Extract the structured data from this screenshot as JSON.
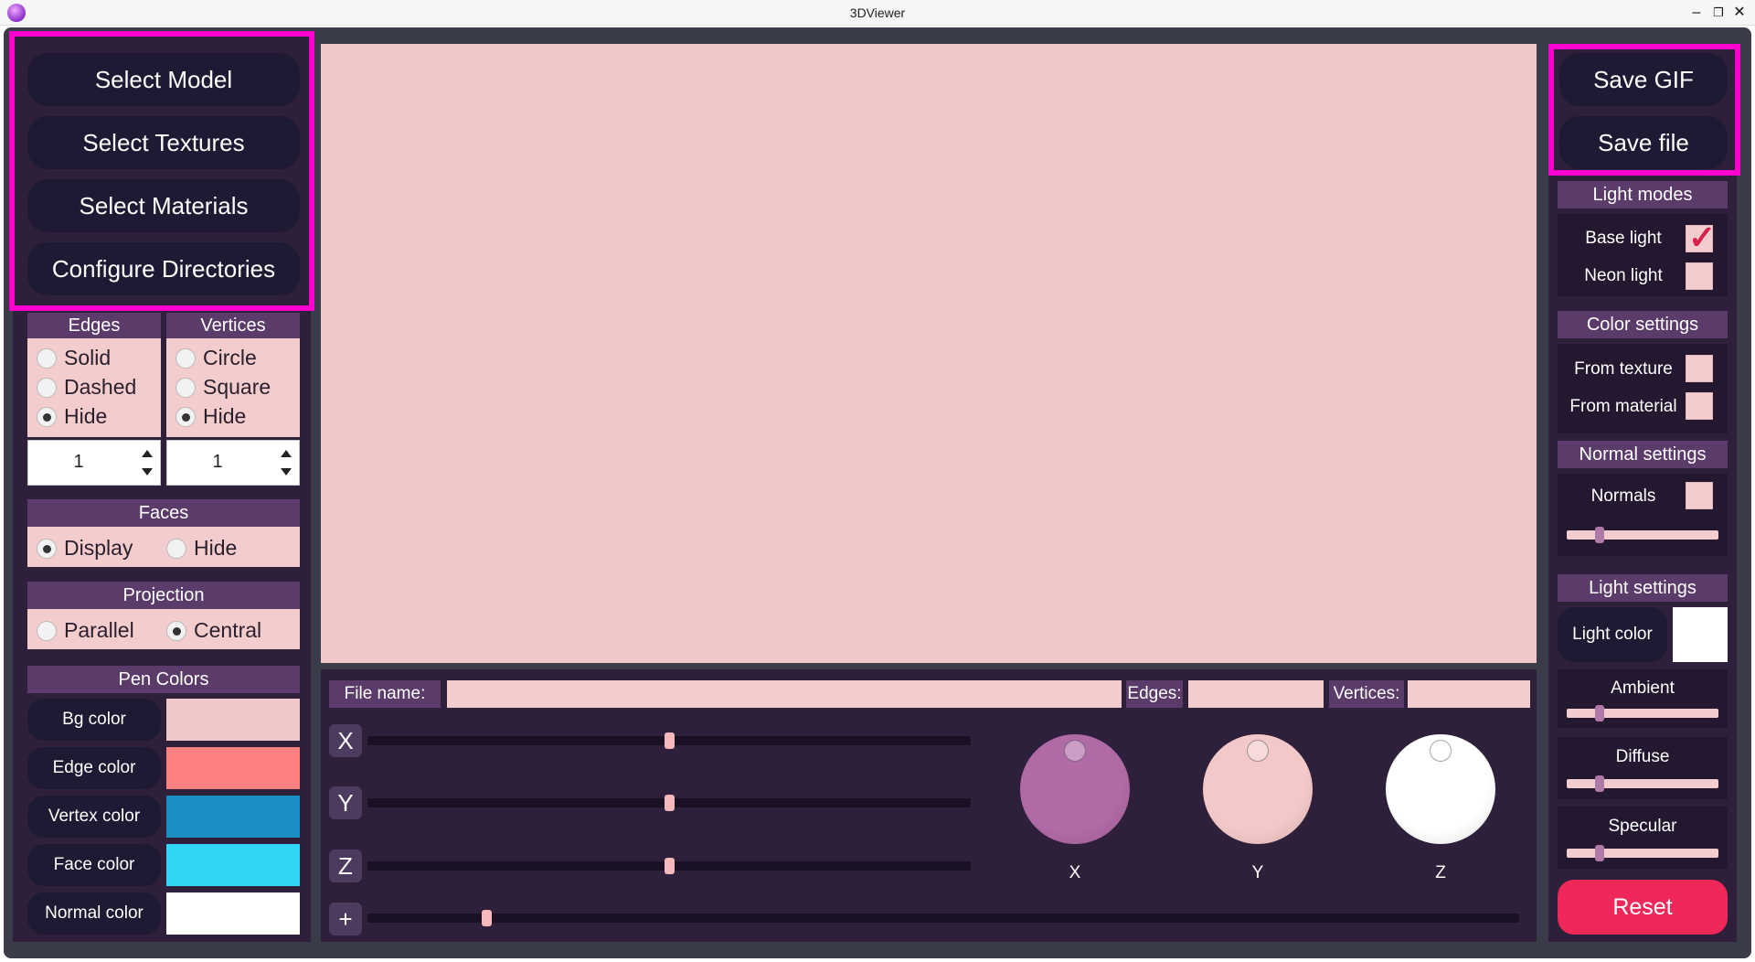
{
  "window": {
    "title": "3DViewer",
    "minimize": "–",
    "restore": "❐",
    "close": "✕"
  },
  "left": {
    "buttons": [
      "Select Model",
      "Select Textures",
      "Select Materials",
      "Configure Directories"
    ],
    "edges": {
      "header": "Edges",
      "options": [
        "Solid",
        "Dashed",
        "Hide"
      ],
      "selected": "Hide",
      "thickness": "1"
    },
    "vertices": {
      "header": "Vertices",
      "options": [
        "Circle",
        "Square",
        "Hide"
      ],
      "selected": "Hide",
      "size": "1"
    },
    "faces": {
      "header": "Faces",
      "options": [
        "Display",
        "Hide"
      ],
      "selected": "Display"
    },
    "projection": {
      "header": "Projection",
      "options": [
        "Parallel",
        "Central"
      ],
      "selected": "Central"
    },
    "pen_colors": {
      "header": "Pen Colors",
      "items": [
        {
          "label": "Bg color",
          "color": "#f0c8c9"
        },
        {
          "label": "Edge color",
          "color": "#ff8080"
        },
        {
          "label": "Vertex color",
          "color": "#1b8fc4"
        },
        {
          "label": "Face color",
          "color": "#33d5f5"
        },
        {
          "label": "Normal color",
          "color": "#ffffff"
        }
      ]
    }
  },
  "viewport": {
    "background": "#f0c8c9"
  },
  "bottom": {
    "file_name_label": "File name:",
    "file_name_value": "",
    "edges_label": "Edges:",
    "edges_value": "",
    "vertices_label": "Vertices:",
    "vertices_value": "",
    "move_axes": [
      "X",
      "Y",
      "Z"
    ],
    "move_values": [
      0.5,
      0.5,
      0.5
    ],
    "scale_label": "+",
    "scale_value": 0.1,
    "rotate_labels": [
      "X",
      "Y",
      "Z"
    ],
    "rotate_colors": [
      "#b06aa6",
      "#f3c8c8",
      "#ffffff"
    ]
  },
  "right": {
    "buttons": [
      "Save GIF",
      "Save file"
    ],
    "light_modes": {
      "header": "Light modes",
      "base_light": "Base light",
      "base_light_checked": true,
      "neon_light": "Neon light",
      "neon_light_checked": false
    },
    "color_settings": {
      "header": "Color settings",
      "from_texture": "From texture",
      "from_texture_checked": false,
      "from_material": "From material",
      "from_material_checked": false
    },
    "normal_settings": {
      "header": "Normal settings",
      "normals": "Normals",
      "normals_checked": false,
      "normals_level": 0.2
    },
    "light_settings": {
      "header": "Light settings",
      "light_color_label": "Light color",
      "light_color": "#ffffff",
      "ambient": "Ambient",
      "ambient_level": 0.2,
      "diffuse": "Diffuse",
      "diffuse_level": 0.2,
      "specular": "Specular",
      "specular_level": 0.2
    },
    "reset": "Reset"
  }
}
